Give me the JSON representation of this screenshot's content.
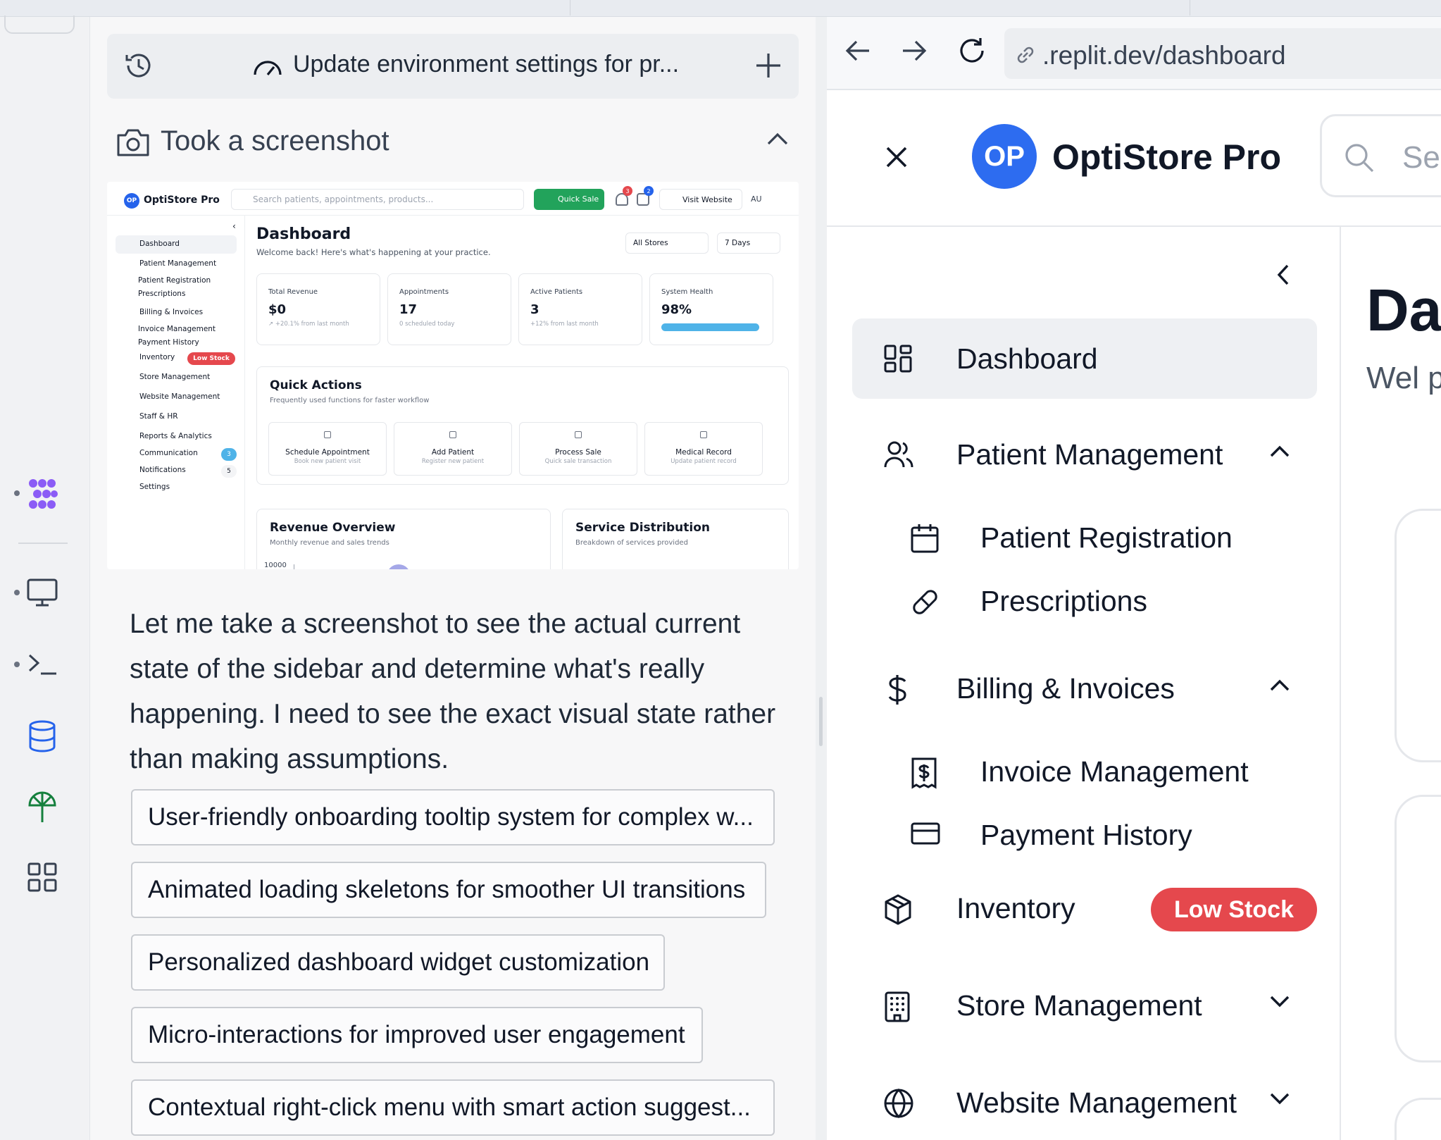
{
  "chat": {
    "header_title": "Update environment settings for pr...",
    "screenshot_label": "Took a screenshot",
    "message": "Let me take a screenshot to see the actual current state of the sidebar and determine what's really happening. I need to see the exact visual state rather than making assumptions.",
    "suggestions": [
      "User-friendly onboarding tooltip system for complex w...",
      "Animated loading skeletons for smoother UI transitions",
      "Personalized dashboard widget customization",
      "Micro-interactions for improved user engagement",
      "Contextual right-click menu with smart action suggest..."
    ]
  },
  "thumbnail": {
    "logo": "OP",
    "brand": "OptiStore Pro",
    "search_placeholder": "Search patients, appointments, products...",
    "quick_sale": "Quick Sale",
    "notif_badge": "3",
    "msg_badge": "2",
    "visit_website": "Visit Website",
    "user": "AU",
    "sidebar": {
      "dashboard": "Dashboard",
      "patient_management": "Patient Management",
      "patient_registration": "Patient Registration",
      "prescriptions": "Prescriptions",
      "billing": "Billing & Invoices",
      "invoice_management": "Invoice Management",
      "payment_history": "Payment History",
      "inventory": "Inventory",
      "low_stock": "Low Stock",
      "store_management": "Store Management",
      "website_management": "Website Management",
      "staff": "Staff & HR",
      "reports": "Reports & Analytics",
      "communication": "Communication",
      "communication_count": "3",
      "notifications": "Notifications",
      "notifications_count": "5",
      "settings": "Settings"
    },
    "main": {
      "title": "Dashboard",
      "subtitle": "Welcome back! Here's what's happening at your practice.",
      "store_filter": "All Stores",
      "range_filter": "7 Days",
      "cards": [
        {
          "label": "Total Revenue",
          "value": "$0",
          "sub": "↗ +20.1% from last month"
        },
        {
          "label": "Appointments",
          "value": "17",
          "sub": "0 scheduled today"
        },
        {
          "label": "Active Patients",
          "value": "3",
          "sub": "+12% from last month"
        },
        {
          "label": "System Health",
          "value": "98%",
          "progress": 0.98
        }
      ],
      "quick_actions_title": "Quick Actions",
      "quick_actions_sub": "Frequently used functions for faster workflow",
      "quick_actions": [
        {
          "title": "Schedule Appointment",
          "sub": "Book new patient visit"
        },
        {
          "title": "Add Patient",
          "sub": "Register new patient"
        },
        {
          "title": "Process Sale",
          "sub": "Quick sale transaction"
        },
        {
          "title": "Medical Record",
          "sub": "Update patient record"
        }
      ],
      "revenue_title": "Revenue Overview",
      "revenue_sub": "Monthly revenue and sales trends",
      "revenue_axis": "10000",
      "service_title": "Service Distribution",
      "service_sub": "Breakdown of services provided"
    }
  },
  "browser": {
    "url": ".replit.dev/dashboard",
    "logo": "OP",
    "brand": "OptiStore Pro",
    "search_placeholder": "Se",
    "nav": {
      "dashboard": "Dashboard",
      "patient_management": "Patient Management",
      "patient_registration": "Patient Registration",
      "prescriptions": "Prescriptions",
      "billing": "Billing & Invoices",
      "invoice_management": "Invoice Management",
      "payment_history": "Payment History",
      "inventory": "Inventory",
      "low_stock": "Low Stock",
      "store_management": "Store Management",
      "website_management": "Website Management"
    },
    "content_title": "Da",
    "content_sub": "Wel prac"
  },
  "colors": {
    "accent_blue": "#2d6cf0",
    "low_stock_red": "#e5484d",
    "quick_sale_green": "#22a35b"
  }
}
